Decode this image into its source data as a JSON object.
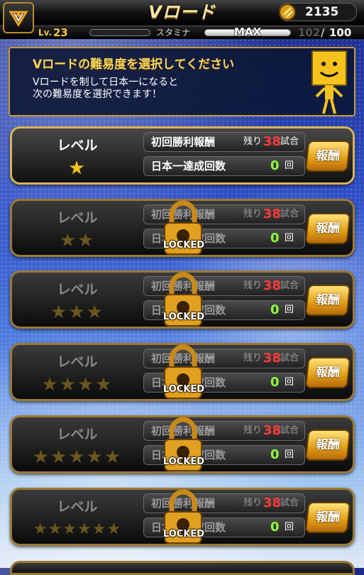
{
  "header": {
    "title": "Vロード",
    "coins": "2135",
    "menu_icon": "team-emblem-icon",
    "coin_icon": "battery-coin-icon"
  },
  "status": {
    "level_label": "Lv.",
    "level": "23",
    "stamina_label": "スタミナ",
    "stamina_max_label": "MAX",
    "stamina_current": "102",
    "stamina_separator": "/",
    "stamina_max": "100"
  },
  "info": {
    "title": "Vロードの難易度を選択してください",
    "line1": "Vロードを制して日本一になると",
    "line2": "次の難易度を選択できます！"
  },
  "levels": [
    {
      "label": "レベル",
      "stars": "★",
      "reward_label": "初回勝利報酬",
      "remain_word": "残り",
      "remain": "38",
      "remain_unit": "試合",
      "champ_label": "日本一達成回数",
      "champ_count": "0",
      "champ_unit": "回",
      "button": "報酬",
      "locked": false
    },
    {
      "label": "レベル",
      "stars": "★★",
      "reward_label": "初回勝利報酬",
      "remain_word": "残り",
      "remain": "38",
      "remain_unit": "試合",
      "champ_label": "日本一達成回数",
      "champ_count": "0",
      "champ_unit": "回",
      "button": "報酬",
      "locked": true,
      "lock_text": "LOCKED"
    },
    {
      "label": "レベル",
      "stars": "★★★",
      "reward_label": "初回勝利報酬",
      "remain_word": "残り",
      "remain": "38",
      "remain_unit": "試合",
      "champ_label": "日本一達成回数",
      "champ_count": "0",
      "champ_unit": "回",
      "button": "報酬",
      "locked": true,
      "lock_text": "LOCKED"
    },
    {
      "label": "レベル",
      "stars": "★★★★",
      "reward_label": "初回勝利報酬",
      "remain_word": "残り",
      "remain": "38",
      "remain_unit": "試合",
      "champ_label": "日本一達成回数",
      "champ_count": "0",
      "champ_unit": "回",
      "button": "報酬",
      "locked": true,
      "lock_text": "LOCKED"
    },
    {
      "label": "レベル",
      "stars": "★★★★★",
      "reward_label": "初回勝利報酬",
      "remain_word": "残り",
      "remain": "38",
      "remain_unit": "試合",
      "champ_label": "日本一達成回数",
      "champ_count": "0",
      "champ_unit": "回",
      "button": "報酬",
      "locked": true,
      "lock_text": "LOCKED"
    },
    {
      "label": "レベル",
      "stars": "★★★★★★",
      "reward_label": "初回勝利報酬",
      "remain_word": "残り",
      "remain": "38",
      "remain_unit": "試合",
      "champ_label": "日本一達成回数",
      "champ_count": "0",
      "champ_unit": "回",
      "button": "報酬",
      "locked": true,
      "lock_text": "LOCKED"
    }
  ],
  "colors": {
    "accent_gold": "#c79b3a",
    "remain_red": "#ff3b3b",
    "count_green": "#8dff3a",
    "star_gold": "#f5c21e"
  }
}
